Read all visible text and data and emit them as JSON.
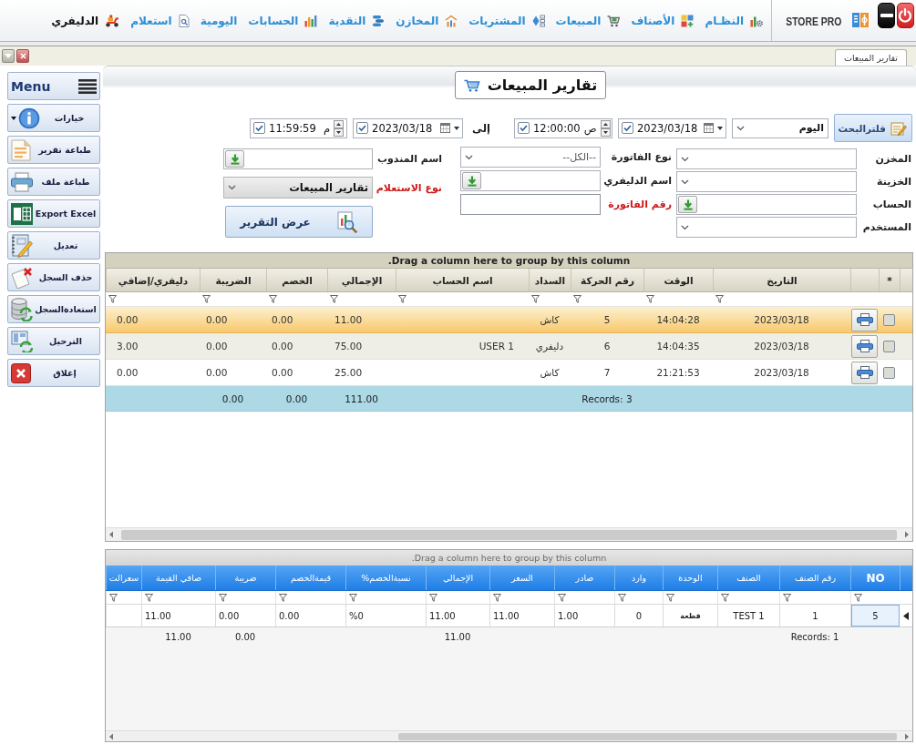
{
  "top_bar": {
    "brand": "STORE PRO",
    "menu": [
      {
        "label": "النظـام",
        "selected": false
      },
      {
        "label": "الأصناف",
        "selected": false
      },
      {
        "label": "المبيعات",
        "selected": false
      },
      {
        "label": "المشتريات",
        "selected": false
      },
      {
        "label": "المخازن",
        "selected": false
      },
      {
        "label": "النقدية",
        "selected": false
      },
      {
        "label": "الحسابات",
        "selected": false
      },
      {
        "label": "اليومية",
        "selected": false
      },
      {
        "label": "استعلام",
        "selected": false
      },
      {
        "label": "الدليفري",
        "selected": true
      }
    ]
  },
  "document_tabs": [
    {
      "label": "تقارير المبيعات",
      "selected": true
    }
  ],
  "sidebar": {
    "items": [
      {
        "kind": "menu",
        "label": "Menu"
      },
      {
        "kind": "dropdown",
        "label": "خيارات"
      },
      {
        "kind": "button",
        "label": "طباعة تقرير"
      },
      {
        "kind": "button",
        "label": "طباعة ملف"
      },
      {
        "kind": "button",
        "label": "Export Excel"
      },
      {
        "kind": "button",
        "label": "تعديل"
      },
      {
        "kind": "button",
        "label": "حذف السجل"
      },
      {
        "kind": "button",
        "label": "استعادةالسجل"
      },
      {
        "kind": "button",
        "label": "الترحيل"
      },
      {
        "kind": "button",
        "label": "إغلاق"
      }
    ]
  },
  "report": {
    "title": "تقارير المبيعات"
  },
  "filter_bar": {
    "search_button": "فلترالبحث",
    "period": "اليوم",
    "from_date": {
      "checked": true,
      "value": "2023/03/18"
    },
    "from_time": {
      "checked": true,
      "value": "12:00:00",
      "meridiem": "ص"
    },
    "to_label": "إلى",
    "to_date": {
      "checked": true,
      "value": "2023/03/18"
    },
    "to_time": {
      "checked": true,
      "value": "11:59:59",
      "meridiem": "م"
    }
  },
  "filter_fields": [
    [
      {
        "kind": "combo",
        "label": "المخزن",
        "required": false
      },
      {
        "kind": "combo",
        "label": "الخزينة",
        "required": false
      },
      {
        "kind": "lookup",
        "label": "الحساب",
        "required": false
      },
      {
        "kind": "combo",
        "label": "المستخدم",
        "required": false
      }
    ],
    [
      {
        "kind": "combo",
        "label": "نوع الفاتورة",
        "required": false,
        "value": "--الكل--"
      },
      {
        "kind": "lookup",
        "label": "اسم الدليفري",
        "required": false
      },
      {
        "kind": "text",
        "label": "رقم الفاتورة",
        "required": true
      }
    ],
    [
      {
        "kind": "lookup",
        "label": "اسم المندوب",
        "required": false
      },
      {
        "kind": "select",
        "label": "نوع الاستعلام",
        "required": true,
        "value": "تقارير المبيعات"
      }
    ]
  ],
  "show_report_button": "عرض التقرير",
  "sales_grid": {
    "group_panel": "Drag a column here to group by this column.",
    "select_header": "*",
    "columns": [
      "التاريخ",
      "الوقت",
      "رقم الحركة",
      "السداد",
      "اسم الحساب",
      "الإجمالي",
      "الخصم",
      "الضريبة",
      "دليفري/إضافي"
    ],
    "rows": [
      {
        "selected": true,
        "checked": false,
        "cells": [
          "2023/03/18",
          "14:04:28",
          "5",
          "كاش",
          null,
          "11.00",
          "0.00",
          "0.00",
          "0.00"
        ]
      },
      {
        "selected": false,
        "checked": false,
        "cells": [
          "2023/03/18",
          "14:04:35",
          "6",
          "دليفري",
          "USER 1",
          "75.00",
          "0.00",
          "0.00",
          "3.00"
        ]
      },
      {
        "selected": false,
        "checked": false,
        "cells": [
          "2023/03/18",
          "21:21:53",
          "7",
          "كاش",
          null,
          "25.00",
          "0.00",
          "0.00",
          "0.00"
        ]
      }
    ],
    "footer": {
      "records": "Records: 3",
      "total": "111.00",
      "discount": "0.00",
      "tax": "0.00"
    }
  },
  "items_grid": {
    "group_panel": "Drag a column here to group by this column.",
    "columns": [
      "NO",
      "رقم الصنف",
      "الصنف",
      "الوحدة",
      "وارد",
      "صادر",
      "السعر",
      "الإجمالي",
      "نسبةالخصم%",
      "قيمةالخصم",
      "ضريبة",
      "صافي القيمة",
      "سعرالت"
    ],
    "rows": [
      {
        "selected": true,
        "cells": [
          "5",
          "1",
          "TEST 1",
          "قطعة",
          "0",
          "1.00",
          "11.00",
          "11.00",
          "%0",
          "0.00",
          "0.00",
          "11.00",
          null
        ]
      }
    ],
    "footer": {
      "records": "Records: 1",
      "total": "11.00",
      "tax": "0.00",
      "net_value": "11.00"
    }
  }
}
